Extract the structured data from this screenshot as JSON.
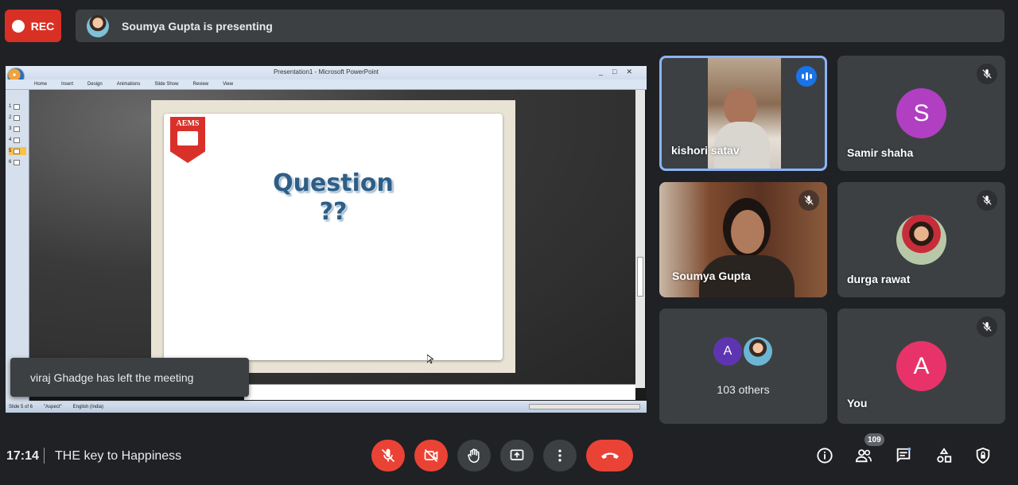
{
  "recording": {
    "label": "REC"
  },
  "presenting": {
    "text": "Soumya Gupta is presenting"
  },
  "presentation": {
    "window_title": "Presentation1 - Microsoft PowerPoint",
    "ribbon_tabs": [
      "Home",
      "Insert",
      "Design",
      "Animations",
      "Slide Show",
      "Review",
      "View"
    ],
    "slide_numbers": [
      "1",
      "2",
      "3",
      "4",
      "5",
      "6"
    ],
    "active_slide": 5,
    "logo_text": "AEMS",
    "slide_title_line1": "Question",
    "slide_title_line2": "??",
    "status_slide": "Slide 5 of 6",
    "status_theme": "\"Aspect\"",
    "status_language": "English (India)"
  },
  "toast": {
    "text": "viraj Ghadge has left the meeting"
  },
  "participants": [
    {
      "name": "kishori satav",
      "type": "video",
      "speaking": true
    },
    {
      "name": "Samir shaha",
      "initial": "S",
      "avatar_color": "#b13fc2",
      "muted": true
    },
    {
      "name": "Soumya Gupta",
      "type": "video",
      "muted": true
    },
    {
      "name": "durga rawat",
      "type": "photo",
      "muted": true
    },
    {
      "others_label": "103 others",
      "initial": "A",
      "avatar_color": "#5e35b1"
    },
    {
      "name": "You",
      "initial": "A",
      "avatar_color": "#e8336a",
      "muted": true
    }
  ],
  "meeting": {
    "time": "17:14",
    "title": "THE key to Happiness"
  },
  "controls": [
    "mic-off",
    "camera-off",
    "raise-hand",
    "present-screen",
    "more-options",
    "leave-call"
  ],
  "right_controls": {
    "people_count": "109"
  },
  "colors": {
    "red": "#ea4335",
    "tile": "#3c4043",
    "bg": "#202124",
    "active_border": "#8ab4f8"
  }
}
